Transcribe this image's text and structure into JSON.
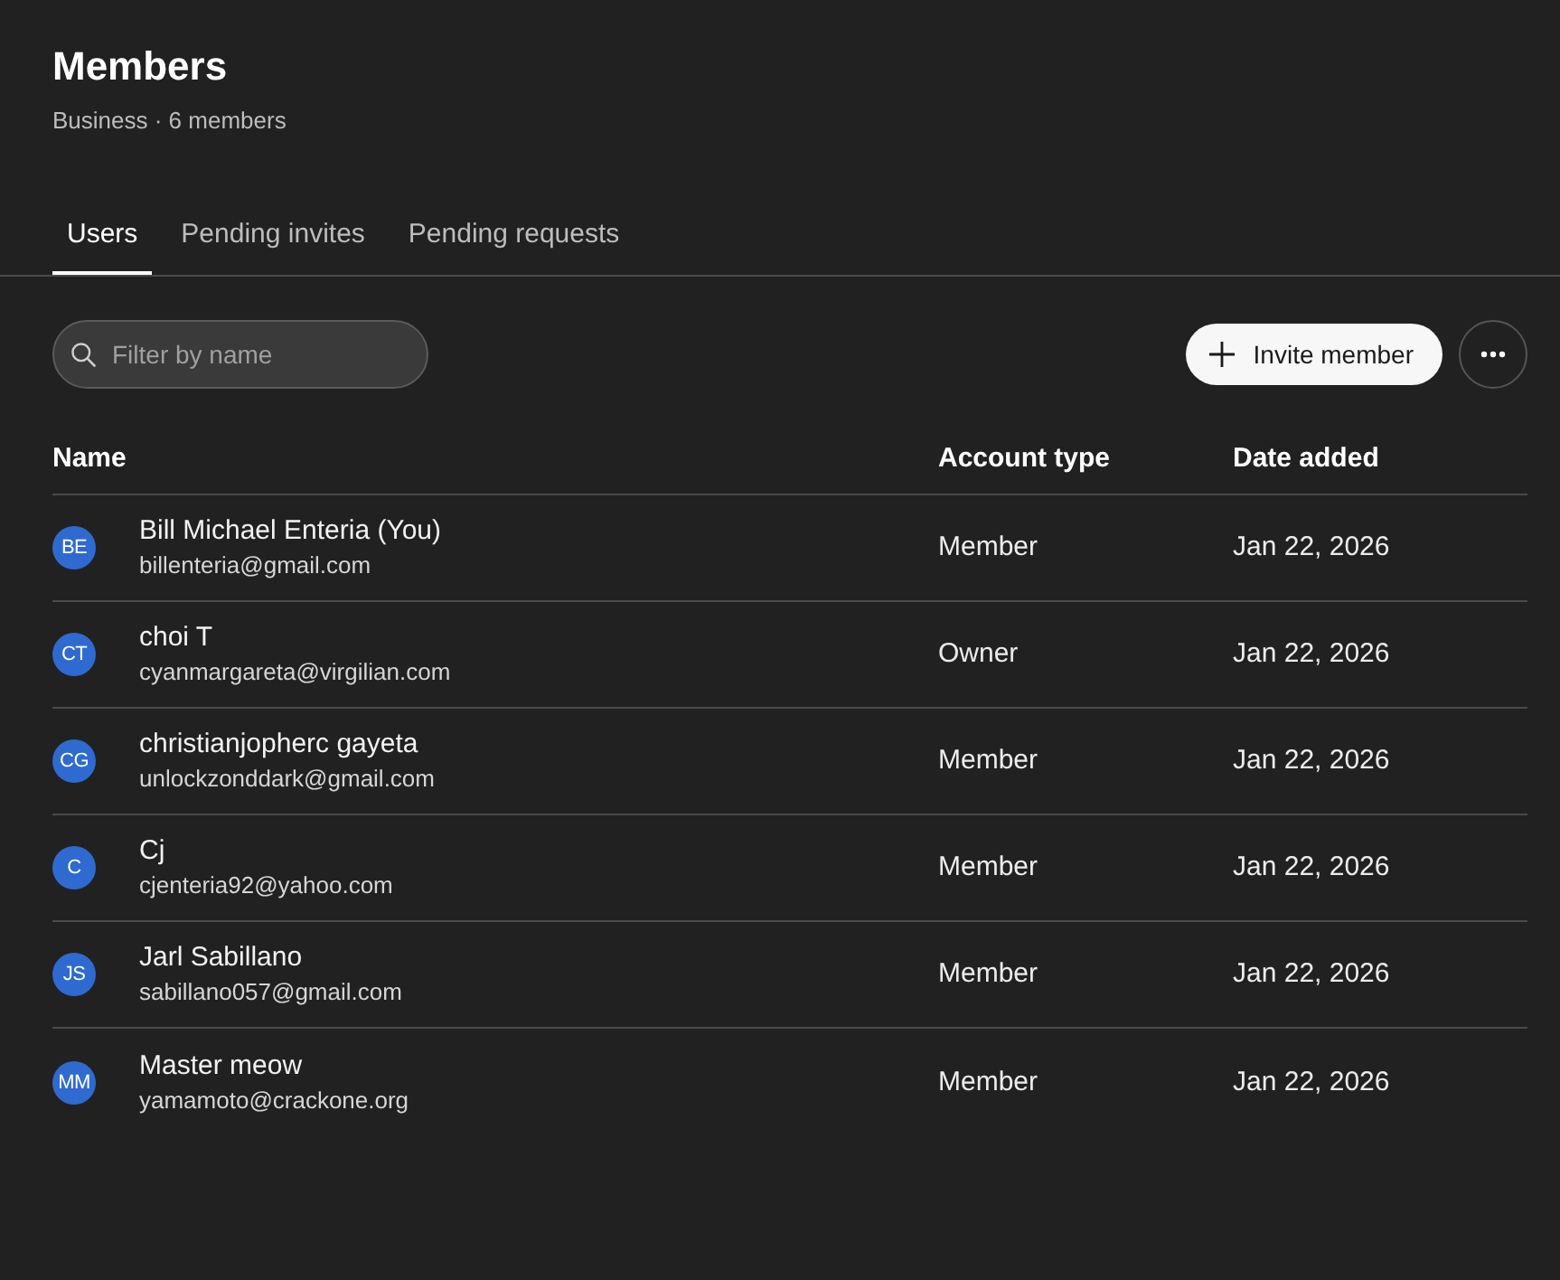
{
  "header": {
    "title": "Members",
    "subtitle": "Business · 6 members"
  },
  "tabs": [
    {
      "label": "Users",
      "selected": true
    },
    {
      "label": "Pending invites",
      "selected": false
    },
    {
      "label": "Pending requests",
      "selected": false
    }
  ],
  "toolbar": {
    "search": {
      "placeholder": "Filter by name"
    },
    "invite_button": "Invite member"
  },
  "table": {
    "columns": [
      "Name",
      "Account type",
      "Date added"
    ],
    "rows": [
      {
        "initials": "BE",
        "name": "Bill Michael Enteria (You)",
        "email": "billenteria@gmail.com",
        "account_type": "Member",
        "date_added": "Jan 22, 2026"
      },
      {
        "initials": "CT",
        "name": "choi T",
        "email": "cyanmargareta@virgilian.com",
        "account_type": "Owner",
        "date_added": "Jan 22, 2026"
      },
      {
        "initials": "CG",
        "name": "christianjopherc gayeta",
        "email": "unlockzonddark@gmail.com",
        "account_type": "Member",
        "date_added": "Jan 22, 2026"
      },
      {
        "initials": "C",
        "name": "Cj",
        "email": "cjenteria92@yahoo.com",
        "account_type": "Member",
        "date_added": "Jan 22, 2026"
      },
      {
        "initials": "JS",
        "name": "Jarl Sabillano",
        "email": "sabillano057@gmail.com",
        "account_type": "Member",
        "date_added": "Jan 22, 2026"
      },
      {
        "initials": "MM",
        "name": "Master meow",
        "email": "yamamoto@crackone.org",
        "account_type": "Member",
        "date_added": "Jan 22, 2026"
      }
    ]
  }
}
